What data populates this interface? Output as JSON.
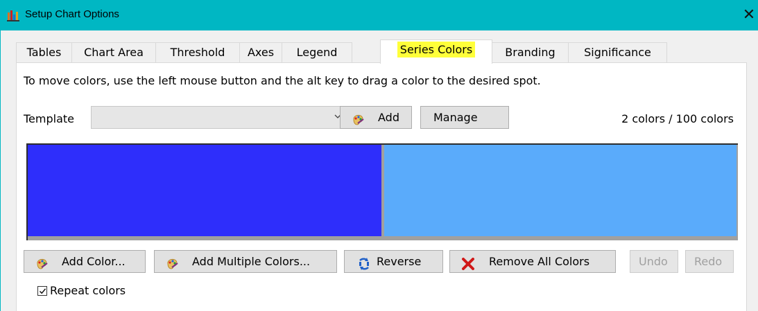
{
  "window": {
    "title": "Setup Chart Options",
    "close_glyph": "✕"
  },
  "tabs": [
    {
      "label": "Tables"
    },
    {
      "label": "Chart Area"
    },
    {
      "label": "Threshold"
    },
    {
      "label": "Axes"
    },
    {
      "label": "Legend"
    },
    {
      "label": "Series Colors",
      "active": true
    },
    {
      "label": "Branding"
    },
    {
      "label": "Significance"
    }
  ],
  "series_colors": {
    "instructions": "To move colors, use the left mouse button and the alt key to drag a color to the desired spot.",
    "template_label": "Template",
    "template_value": "",
    "add_template_label": "Add",
    "manage_label": "Manage",
    "color_count": "2 colors / 100 colors",
    "swatches": [
      {
        "color": "#2e2efb"
      },
      {
        "color": "#5aabfb"
      }
    ],
    "buttons": {
      "add_color": "Add Color...",
      "add_multiple": "Add Multiple Colors...",
      "reverse": "Reverse",
      "remove_all": "Remove All Colors",
      "undo": "Undo",
      "redo": "Redo"
    },
    "repeat_colors": {
      "label": "Repeat colors",
      "checked": true
    }
  },
  "colors": {
    "titlebar": "#00b7c3",
    "active_tab_highlight": "#ffff3a"
  },
  "icons": {
    "app": "bar-chart-icon",
    "palette": "palette-icon",
    "reverse": "reverse-arrows-icon",
    "remove": "red-x-icon"
  }
}
